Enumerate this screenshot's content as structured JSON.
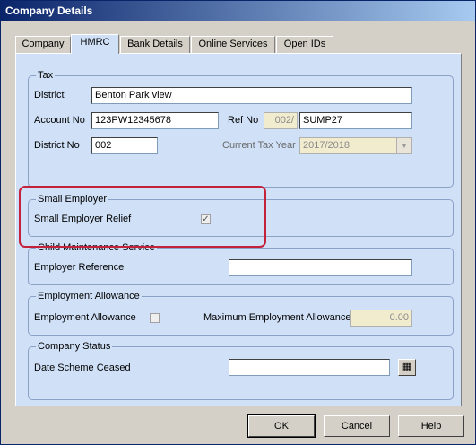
{
  "window": {
    "title": "Company Details"
  },
  "tabs": [
    {
      "label": "Company"
    },
    {
      "label": "HMRC"
    },
    {
      "label": "Bank Details"
    },
    {
      "label": "Online Services"
    },
    {
      "label": "Open IDs"
    }
  ],
  "tax": {
    "group_label": "Tax",
    "district_label": "District",
    "district_value": "Benton Park view",
    "account_no_label": "Account No",
    "account_no_value": "123PW12345678",
    "ref_no_label": "Ref No",
    "ref_no_prefix": "002/",
    "ref_no_value": "SUMP27",
    "district_no_label": "District No",
    "district_no_value": "002",
    "current_tax_year_label": "Current Tax Year",
    "current_tax_year_value": "2017/2018"
  },
  "small_employer": {
    "group_label": "Small Employer",
    "relief_label": "Small Employer Relief",
    "relief_checked": true
  },
  "child_maintenance": {
    "group_label": "Child Maintenance Service",
    "employer_ref_label": "Employer Reference",
    "employer_ref_value": ""
  },
  "employment_allowance": {
    "group_label": "Employment Allowance",
    "allowance_label": "Employment Allowance",
    "allowance_checked": false,
    "max_label": "Maximum Employment Allowance",
    "max_value": "0.00"
  },
  "company_status": {
    "group_label": "Company Status",
    "date_ceased_label": "Date Scheme Ceased",
    "date_ceased_value": ""
  },
  "buttons": {
    "ok": "OK",
    "cancel": "Cancel",
    "help": "Help"
  },
  "colors": {
    "highlight": "#c4213a",
    "panel": "#cfe0f7",
    "title_bar": "#0a246a"
  }
}
